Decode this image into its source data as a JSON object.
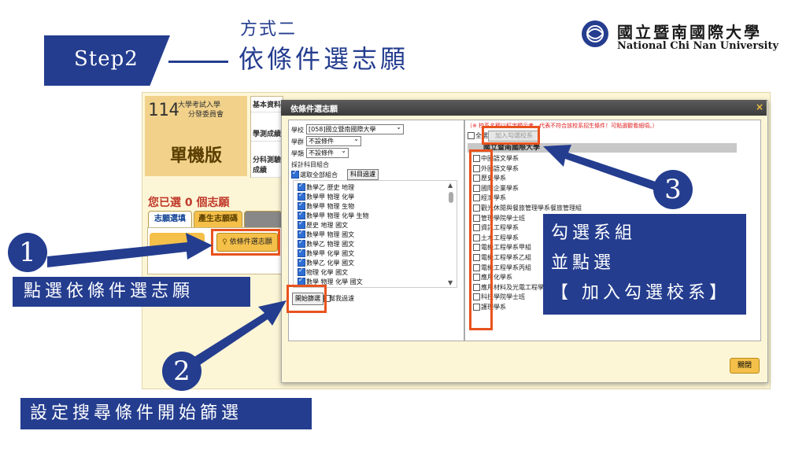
{
  "header": {
    "step": "Step2",
    "method_label": "方式二",
    "method_title": "依條件選志願",
    "university_cn": "國立暨南國際大學",
    "university_en": "National Chi Nan University"
  },
  "app": {
    "logo_num": "114",
    "logo_line1": "大學考試入學",
    "logo_line2": "分發委員會",
    "title": "單機版",
    "basic_info": [
      "基本資料",
      "學測成績",
      "分科測驗成績"
    ],
    "selected_count_text": "您已選 0 個志願",
    "tabs": [
      "志願選填",
      "產生志願碼",
      ""
    ],
    "criteria_button": "依條件選志願"
  },
  "dialog": {
    "title": "依條件選志願",
    "school_label": "學校",
    "school_value": "[058]國立暨南國際大學",
    "group_label": "學群",
    "group_value": "不設條件",
    "type_label": "學類",
    "type_value": "不設條件",
    "subject_combo_label": "採計科目組合",
    "select_all_combos": "選取全部組合",
    "subject_filter_button": "科目過濾",
    "combos": [
      "數學乙 歷史 地理",
      "數學甲 物理 化學",
      "數學甲 物理 生物",
      "數學甲 物理 化學 生物",
      "歷史 地理 國文",
      "數學甲 物理 國文",
      "數學乙 物理 國文",
      "數學甲 化學 國文",
      "數學乙 化學 國文",
      "物理 化學 國文",
      "數學 物理 化學 國文"
    ],
    "start_filter_button": "開始篩選",
    "help_filter": "幫我過濾",
    "red_note": "（※ 校系名稱以紅字顯示者，代表不符合該校系招生條件！可點選觀看細項。）",
    "select_all": "全選",
    "add_selected_button": "加入勾選校系",
    "university_header": "國立暨南國際大學",
    "departments": [
      "中國語文學系",
      "外國語文學系",
      "歷史學系",
      "國際企業學系",
      "經濟學系",
      "觀光休閒與餐旅管理學系餐旅管理組",
      "管理學院學士班",
      "資訊工程學系",
      "土木工程學系",
      "電機工程學系甲組",
      "電機工程學系乙組",
      "電機工程學系丙組",
      "應用化學系",
      "應用材料及光電工程學系",
      "科技學院學士班",
      "護理學系"
    ],
    "close_button": "關閉"
  },
  "annotations": {
    "num1": "1",
    "num2": "2",
    "num3": "3",
    "note1": "點選依條件選志願",
    "note2": "設定搜尋條件開始篩選",
    "note3_line1": "勾選系組",
    "note3_line2": "並點選",
    "note3_line3": "【 加入勾選校系】"
  },
  "colors": {
    "accent_blue": "#243d8f",
    "highlight": "#e8531e",
    "app_yellow": "#f5c04a"
  }
}
